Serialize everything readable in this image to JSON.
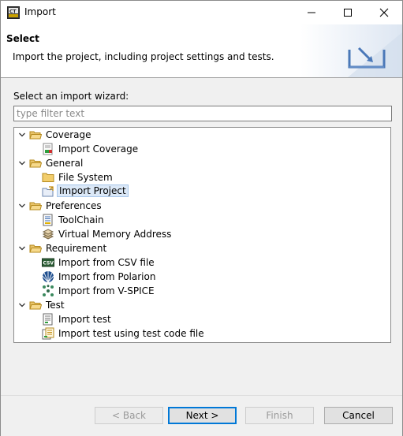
{
  "window": {
    "title": "Import"
  },
  "banner": {
    "title": "Select",
    "description": "Import the project, including project settings and tests."
  },
  "wizard": {
    "label": "Select an import wizard:",
    "filter_placeholder": "type filter text",
    "filter_value": ""
  },
  "tree": {
    "categories": [
      {
        "label": "Coverage",
        "expanded": true,
        "items": [
          {
            "label": "Import Coverage",
            "icon": "coverage-icon"
          }
        ]
      },
      {
        "label": "General",
        "expanded": true,
        "items": [
          {
            "label": "File System",
            "icon": "folder-icon"
          },
          {
            "label": "Import Project",
            "icon": "project-import-icon",
            "selected": true
          }
        ]
      },
      {
        "label": "Preferences",
        "expanded": true,
        "items": [
          {
            "label": "ToolChain",
            "icon": "toolchain-icon"
          },
          {
            "label": "Virtual Memory Address",
            "icon": "memory-icon"
          }
        ]
      },
      {
        "label": "Requirement",
        "expanded": true,
        "items": [
          {
            "label": "Import from CSV file",
            "icon": "csv-icon"
          },
          {
            "label": "Import from Polarion",
            "icon": "polarion-icon"
          },
          {
            "label": "Import from V-SPICE",
            "icon": "vspice-icon"
          }
        ]
      },
      {
        "label": "Test",
        "expanded": true,
        "items": [
          {
            "label": "Import test",
            "icon": "test-file-icon"
          },
          {
            "label": "Import test using test code file",
            "icon": "test-code-icon"
          }
        ]
      }
    ]
  },
  "buttons": {
    "back": "< Back",
    "next": "Next >",
    "finish": "Finish",
    "cancel": "Cancel"
  }
}
